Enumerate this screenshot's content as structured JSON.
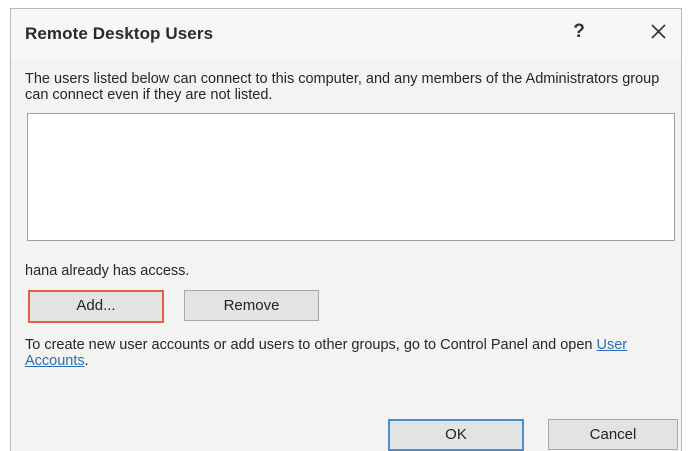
{
  "dialog": {
    "title": "Remote Desktop Users",
    "help_label": "?",
    "close_icon": "close-icon",
    "intro_text": "The users listed below can connect to this computer, and any members of the Administrators group can connect even if they are not listed.",
    "user_list": [],
    "access_text": "hana already has access.",
    "add_label": "Add...",
    "remove_label": "Remove",
    "create_text_before": "To create new user accounts or add users to other groups, go to Control Panel and open ",
    "create_link": "User Accounts",
    "create_text_after": ".",
    "ok_label": "OK",
    "cancel_label": "Cancel"
  },
  "colors": {
    "focus_outline": "#e0623a",
    "default_button_border": "#4a8ed0",
    "link": "#2a6fb5"
  }
}
